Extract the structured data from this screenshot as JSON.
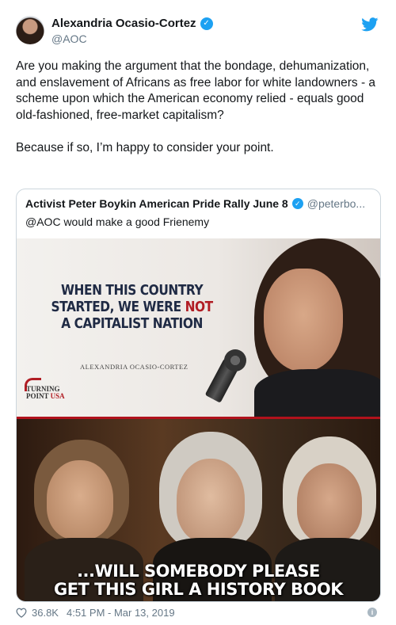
{
  "author": {
    "name": "Alexandria Ocasio-Cortez",
    "handle": "@AOC",
    "verified": true
  },
  "tweet": {
    "text": "Are you making the argument that the bondage, dehumanization, and enslavement of Africans as free labor for white landowners - a scheme upon which the American economy relied - equals good old-fashioned, free-market capitalism?\n\nBecause if so, I’m happy to consider your point."
  },
  "quoted_tweet": {
    "author_name": "Activist Peter Boykin American Pride Rally June 8",
    "handle": "@peterbo...",
    "verified": true,
    "text": "@AOC would make a good Frienemy",
    "image": {
      "headline_line1": "WHEN THIS COUNTRY",
      "headline_line2_a": "STARTED, WE WERE ",
      "headline_line2_b": "NOT",
      "headline_line3": "A CAPITALIST NATION",
      "attribution": "ALEXANDRIA OCASIO-CORTEZ",
      "logo_line1": "TURNING",
      "logo_line2_a": "POINT ",
      "logo_line2_b": "USA",
      "caption_line1": "...WILL SOMEBODY PLEASE",
      "caption_line2": "GET THIS GIRL A HISTORY BOOK"
    }
  },
  "footer": {
    "likes": "36.8K",
    "timestamp": "4:51 PM - Mar 13, 2019"
  },
  "colors": {
    "twitter_blue": "#1da1f2",
    "secondary_text": "#657786",
    "border": "#ccd6dd",
    "meme_red": "#b11d24"
  },
  "icons": {
    "platform": "twitter-bird-icon",
    "verified": "verified-badge-icon",
    "like": "heart-icon",
    "info": "info-icon"
  }
}
